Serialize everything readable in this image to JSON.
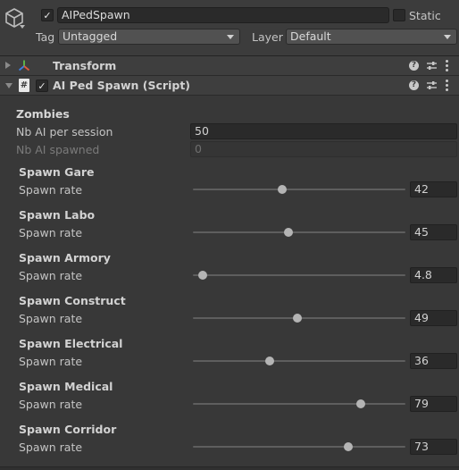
{
  "header": {
    "name": "AIPedSpawn",
    "active_check": "✓",
    "static_label": "Static",
    "tag_label": "Tag",
    "tag_value": "Untagged",
    "layer_label": "Layer",
    "layer_value": "Default"
  },
  "components": {
    "transform": {
      "title": "Transform"
    },
    "script": {
      "title": "AI Ped Spawn (Script)",
      "enabled_check": "✓",
      "file_glyph": "#"
    },
    "help_glyph": "?"
  },
  "zombies": {
    "section": "Zombies",
    "nb_per_session_label": "Nb AI per session",
    "nb_per_session_value": "50",
    "nb_spawned_label": "Nb AI spawned",
    "nb_spawned_value": "0"
  },
  "spawns": [
    {
      "title": "Spawn Gare",
      "label": "Spawn rate",
      "value": "42",
      "level": 0.42
    },
    {
      "title": "Spawn Labo",
      "label": "Spawn rate",
      "value": "45",
      "level": 0.45
    },
    {
      "title": "Spawn Armory",
      "label": "Spawn rate",
      "value": "4.8",
      "level": 0.048
    },
    {
      "title": "Spawn Construct",
      "label": "Spawn rate",
      "value": "49",
      "level": 0.49
    },
    {
      "title": "Spawn Electrical",
      "label": "Spawn rate",
      "value": "36",
      "level": 0.36
    },
    {
      "title": "Spawn Medical",
      "label": "Spawn rate",
      "value": "79",
      "level": 0.79
    },
    {
      "title": "Spawn Corridor",
      "label": "Spawn rate",
      "value": "73",
      "level": 0.73
    }
  ],
  "colors": {
    "panel": "#383838",
    "field": "#2a2a2a",
    "accent_text": "#d2d2d2"
  },
  "icons": [
    "gameobject-cube-icon",
    "transform-axes-icon",
    "script-file-icon",
    "help-icon",
    "presets-icon",
    "context-menu-icon"
  ]
}
